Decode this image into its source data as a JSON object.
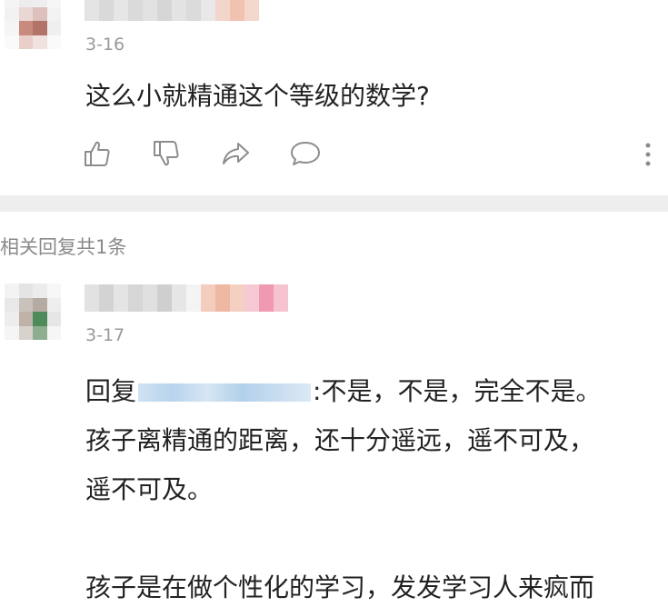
{
  "comment": {
    "date": "3-16",
    "text": "这么小就精通这个等级的数学?"
  },
  "actions": {
    "like": "thumbs-up-icon",
    "dislike": "thumbs-down-icon",
    "share": "share-icon",
    "reply": "comment-bubble-icon",
    "more": "more-vertical-icon"
  },
  "related": {
    "count_label": "相关回复共1条"
  },
  "reply": {
    "date": "3-17",
    "prefix": "回复",
    "text_after_mention": ":不是，不是，完全不是。",
    "line2": "孩子离精通的距离，还十分遥远，遥不可及，",
    "line3": "遥不可及。",
    "line5": "孩子是在做个性化的学习，发发学习人来疯而"
  },
  "colors": {
    "divider": "#eeeeee",
    "date_gray": "#9a9a9a",
    "icon_gray": "#8c8c8c"
  }
}
